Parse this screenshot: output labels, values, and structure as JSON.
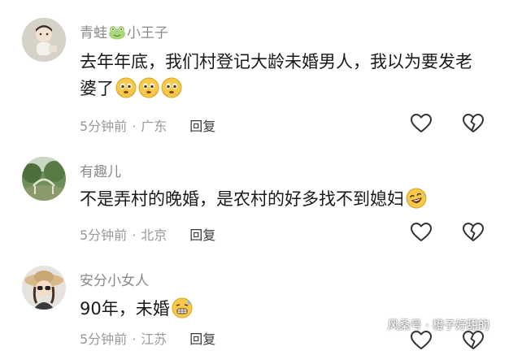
{
  "comments": [
    {
      "username": "青蛙",
      "username_suffix": "小王子",
      "text": "去年年底，我们村登记大龄未婚男人，我以为要发老婆了",
      "time": "5分钟前",
      "separator": "·",
      "location": "广东",
      "reply_label": "回复",
      "avatar_icon": "avatar-cartoon-boy-icon",
      "trailing_emojis": [
        "crying-face-icon",
        "crying-face-icon",
        "crying-face-icon"
      ]
    },
    {
      "username": "有趣儿",
      "text": "不是弄村的晚婚，是农村的好多找不到媳妇",
      "time": "5分钟前",
      "separator": "·",
      "location": "北京",
      "reply_label": "回复",
      "avatar_icon": "avatar-landscape-photo-icon",
      "trailing_emojis": [
        "laughing-tears-face-icon"
      ]
    },
    {
      "username": "安分小女人",
      "text": "90年，未婚",
      "time": "5分钟前",
      "separator": "·",
      "location": "江苏",
      "reply_label": "回复",
      "avatar_icon": "avatar-woman-hat-photo-icon",
      "trailing_emojis": [
        "grimacing-sweat-face-icon"
      ]
    }
  ],
  "watermark": "风桑号 · 橙子好甜的",
  "colors": {
    "username": "#8a8a8a",
    "meta": "#9a9a9a",
    "body_text": "#1a1a1a",
    "icon_stroke": "#333333"
  }
}
